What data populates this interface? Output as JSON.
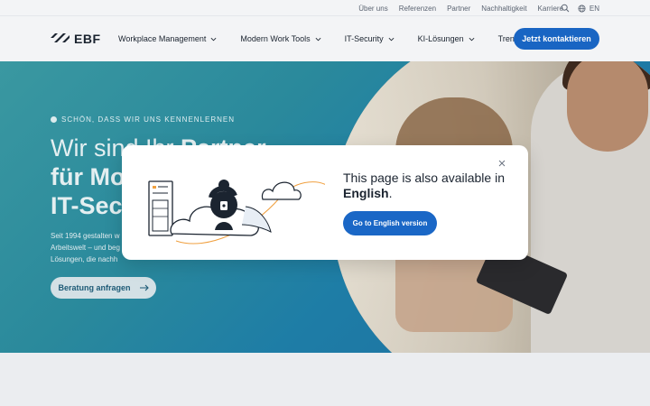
{
  "topbar": {
    "links": [
      "Über uns",
      "Referenzen",
      "Partner",
      "Nachhaltigkeit",
      "Karriere"
    ],
    "lang": "EN"
  },
  "logo": {
    "text": "EBF"
  },
  "nav": {
    "items": [
      {
        "label": "Workplace Management",
        "has_chevron": true
      },
      {
        "label": "Modern Work Tools",
        "has_chevron": true
      },
      {
        "label": "IT-Security",
        "has_chevron": true
      },
      {
        "label": "KI-Lösungen",
        "has_chevron": true
      },
      {
        "label": "Trends",
        "has_chevron": false
      }
    ],
    "cta": "Jetzt kontaktieren"
  },
  "hero": {
    "eyebrow": "SCHÖN, DASS WIR UNS KENNENLERNEN",
    "headline_line1_light": "Wir sind Ihr ",
    "headline_line1_bold": "Partner",
    "headline_line2": "für Mo",
    "headline_line3": "IT-Sec",
    "lead_line1": "Seit 1994 gestalten w",
    "lead_line2": "Arbeitswelt – und beg",
    "lead_line3": "Lösungen, die nachh",
    "button": "Beratung anfragen"
  },
  "modal": {
    "message_prefix": "This page is also available in ",
    "message_bold": "English",
    "message_suffix": ".",
    "button": "Go to English version"
  },
  "colors": {
    "brand_blue": "#1a67c6",
    "hero_teal": "#2b8b9e"
  }
}
